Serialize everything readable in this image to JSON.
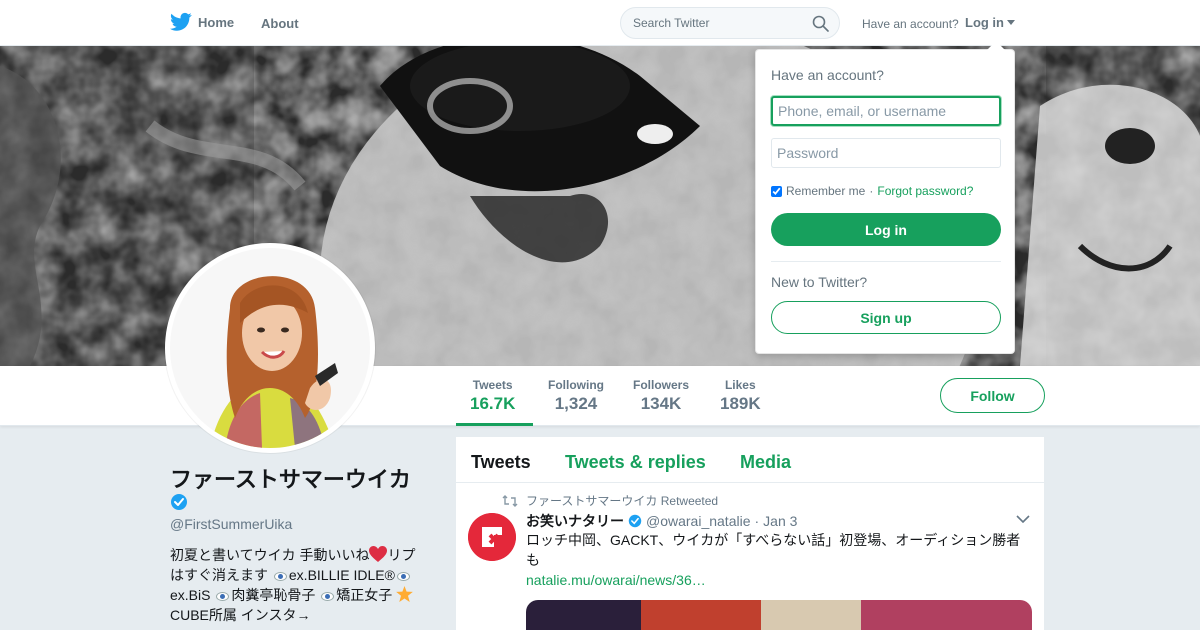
{
  "nav": {
    "home_label": "Home",
    "about_label": "About",
    "search_placeholder": "Search Twitter",
    "have_account": "Have an account?",
    "login_label": "Log in"
  },
  "profile": {
    "name": "ファーストサマーウイカ",
    "handle": "@FirstSummerUika",
    "bio": {
      "part1": "初夏と書いてウイカ 手動いいね",
      "part2": "リプはすぐ消えます ",
      "part3": "ex.BILLIE IDLE®",
      "part4": "ex.BiS ",
      "part5": "肉糞亭恥骨子 ",
      "part6": "矯正女子 ",
      "part7": "CUBE所属 インスタ→"
    },
    "follow_label": "Follow",
    "stats": [
      {
        "label": "Tweets",
        "value": "16.7K"
      },
      {
        "label": "Following",
        "value": "1,324"
      },
      {
        "label": "Followers",
        "value": "134K"
      },
      {
        "label": "Likes",
        "value": "189K"
      }
    ]
  },
  "timeline": {
    "tabs": [
      "Tweets",
      "Tweets & replies",
      "Media"
    ],
    "tweet": {
      "retweeted_by": "ファーストサマーウイカ Retweeted",
      "author_name": "お笑いナタリー",
      "author_handle": "@owarai_natalie",
      "separator": "·",
      "date": "Jan 3",
      "text": "ロッチ中岡、GACKT、ウイカが「すべらない話」初登場、オーディション勝者も",
      "link": "natalie.mu/owarai/news/36…"
    }
  },
  "login_dropdown": {
    "title": "Have an account?",
    "username_placeholder": "Phone, email, or username",
    "password_placeholder": "Password",
    "remember_label": "Remember me",
    "separator": "·",
    "forgot_label": "Forgot password?",
    "login_button": "Log in",
    "new_label": "New to Twitter?",
    "signup_button": "Sign up"
  },
  "colors": {
    "accent": "#17a05d",
    "verified": "#1da1f2",
    "twitter_blue": "#1da1f2"
  }
}
